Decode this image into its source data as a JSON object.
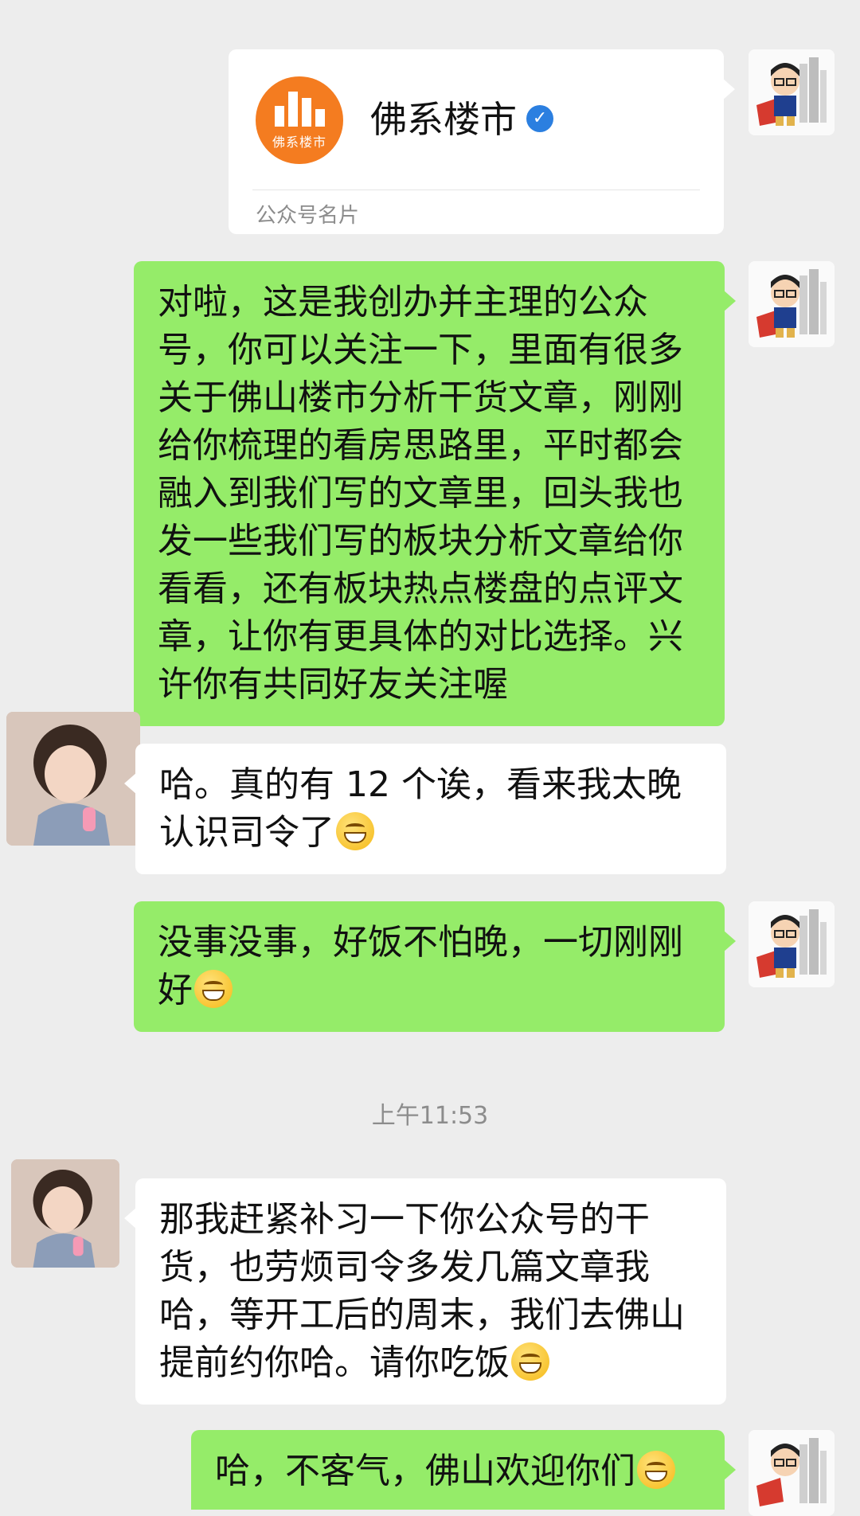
{
  "card": {
    "name": "佛系楼市",
    "logo_text": "佛系楼市",
    "type_label": "公众号名片"
  },
  "messages": [
    {
      "from": "me",
      "text": "对啦，这是我创办并主理的公众号，你可以关注一下，里面有很多关于佛山楼市分析干货文章，刚刚给你梳理的看房思路里，平时都会融入到我们写的文章里，回头我也发一些我们写的板块分析文章给你看看，还有板块热点楼盘的点评文章，让你有更具体的对比选择。兴许你有共同好友关注喔"
    },
    {
      "from": "them",
      "text": "哈。真的有 12 个诶，看来我太晚认识司令了",
      "emoji": "facepalm-laugh-emoji"
    },
    {
      "from": "me",
      "text": "没事没事，好饭不怕晚，一切刚刚好",
      "emoji": "tears-of-joy-emoji"
    },
    {
      "from": "them",
      "text": "那我赶紧补习一下你公众号的干货，也劳烦司令多发几篇文章我哈，等开工后的周末，我们去佛山提前约你哈。请你吃饭",
      "emoji": "grin-emoji"
    },
    {
      "from": "me",
      "text": "哈，不客气，佛山欢迎你们",
      "emoji": "grin-emoji"
    }
  ],
  "timestamp": "上午11:53",
  "colors": {
    "green_bubble": "#95ec69",
    "white_bubble": "#ffffff",
    "background": "#ededed",
    "logo": "#f47c20"
  }
}
